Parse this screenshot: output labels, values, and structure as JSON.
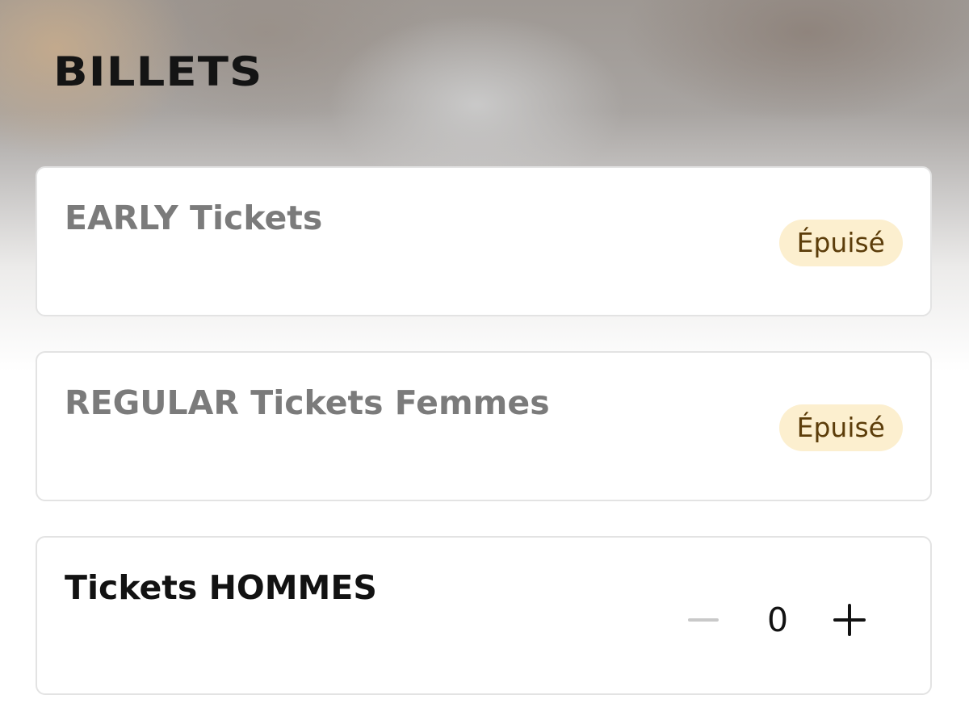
{
  "page": {
    "title": "BILLETS"
  },
  "tickets": [
    {
      "name": "EARLY Tickets",
      "status": "Épuisé"
    },
    {
      "name": "REGULAR Tickets Femmes",
      "status": "Épuisé"
    },
    {
      "name": "Tickets HOMMES",
      "quantity": "0"
    }
  ],
  "colors": {
    "badge_background": "#fcefcf",
    "badge_text": "#5c3d0a",
    "disabled_text": "#7b7b7b",
    "active_text": "#121212",
    "card_border": "#e3e3e3"
  },
  "icons": {
    "decrement": "minus-icon",
    "increment": "plus-icon"
  }
}
